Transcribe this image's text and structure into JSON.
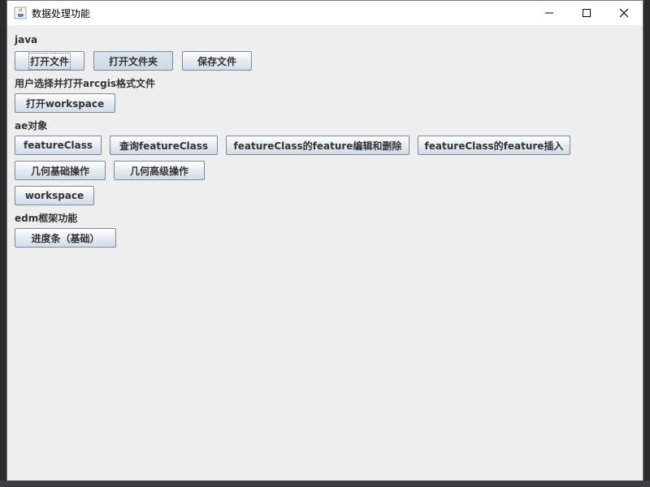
{
  "window": {
    "title": "数据处理功能"
  },
  "sections": {
    "java": {
      "label": "java",
      "buttons": [
        "打开文件",
        "打开文件夹",
        "保存文件"
      ]
    },
    "arcgis": {
      "label": "用户选择并打开arcgis格式文件",
      "buttons": [
        "打开workspace"
      ]
    },
    "ae": {
      "label": "ae对象",
      "buttons": [
        "featureClass",
        "查询featureClass",
        "featureClass的feature编辑和删除",
        "featureClass的feature插入",
        "几何基础操作",
        "几何高级操作",
        "workspace"
      ]
    },
    "edm": {
      "label": "edm框架功能",
      "buttons": [
        "进度条（基础）"
      ]
    }
  },
  "icons": {
    "app": "java-cup-icon",
    "minimize": "minimize-icon",
    "maximize": "maximize-icon",
    "close": "close-icon"
  }
}
